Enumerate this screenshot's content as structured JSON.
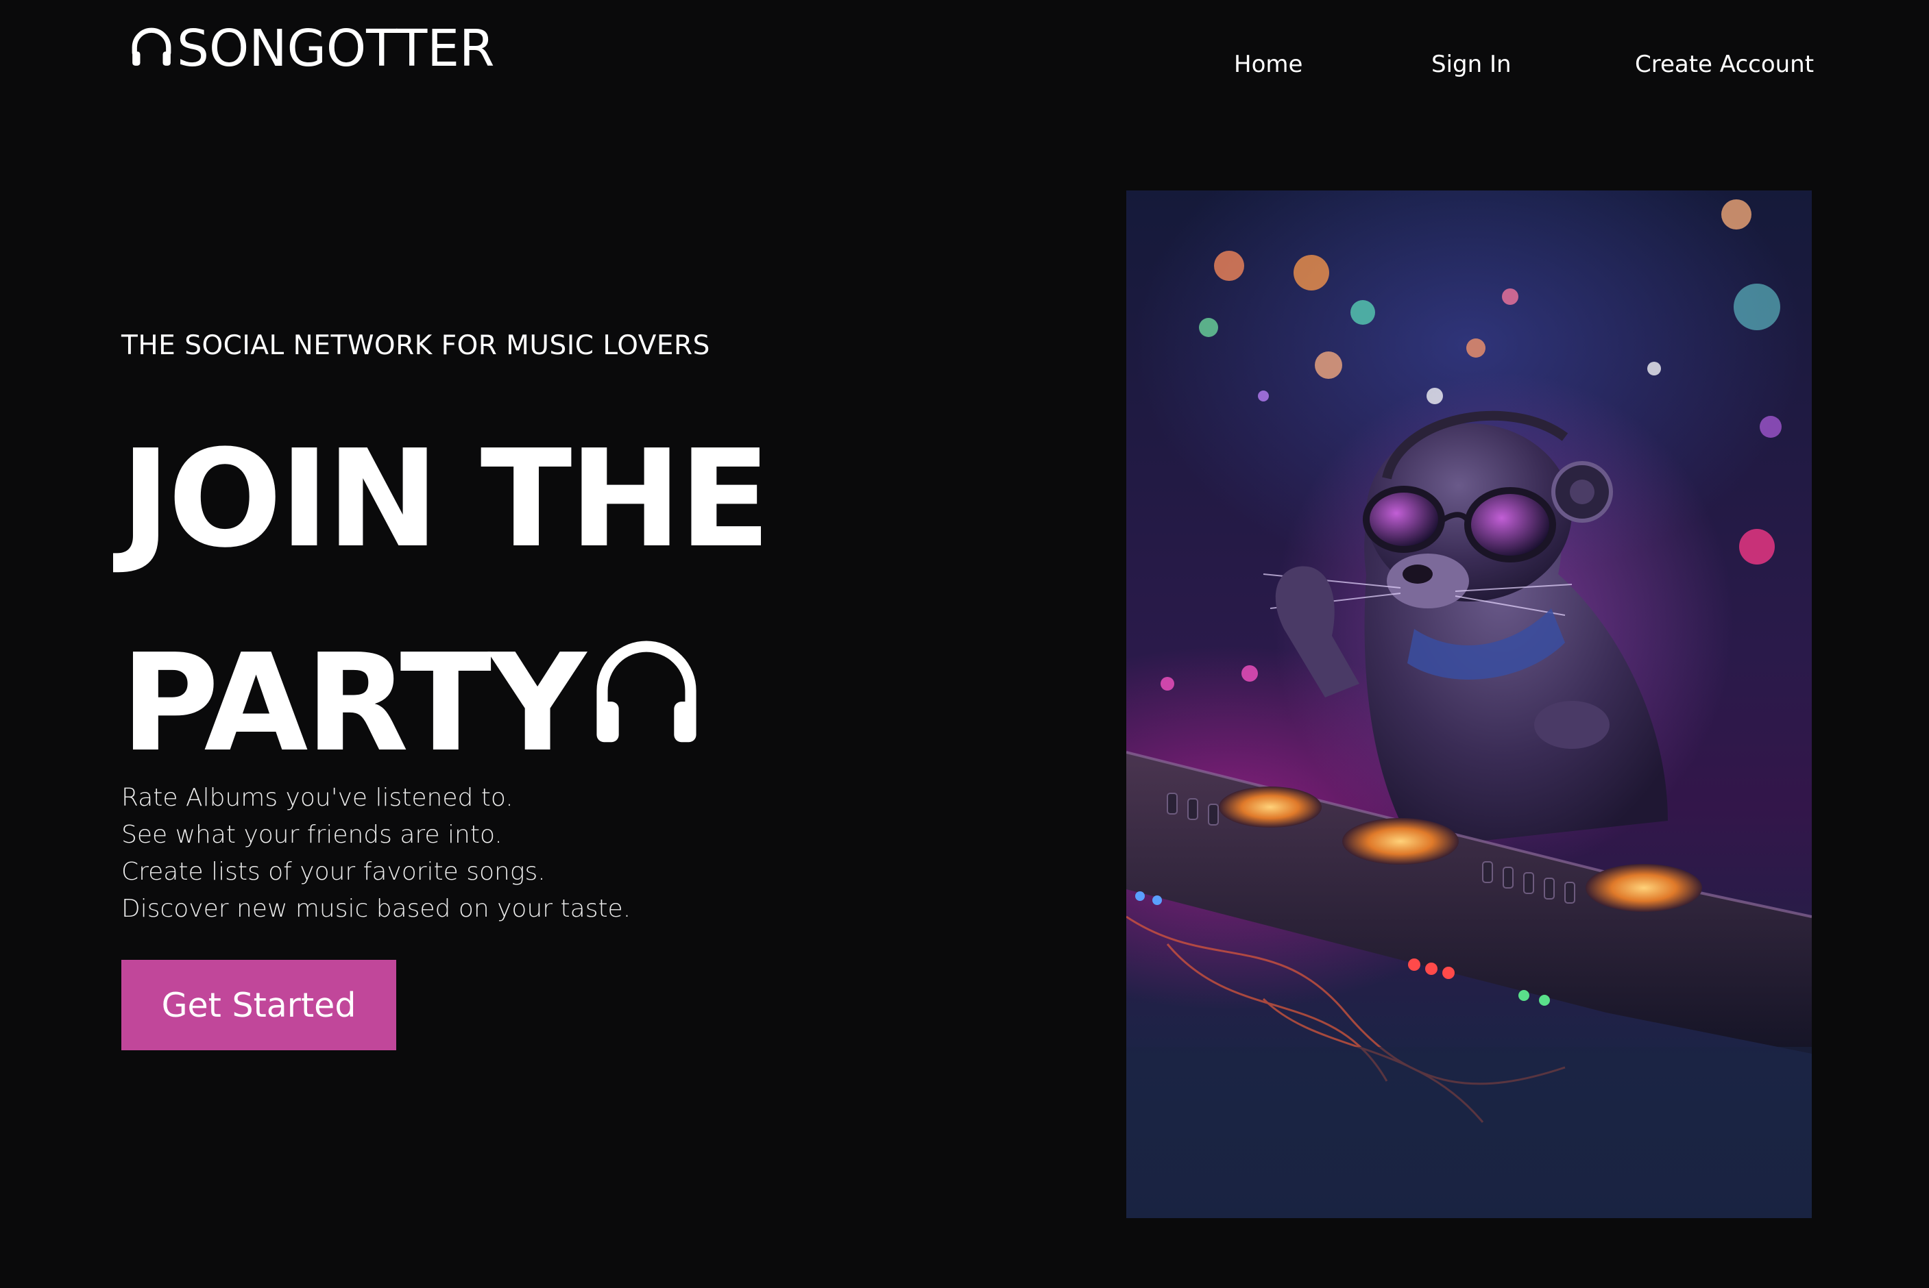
{
  "header": {
    "brand": "SONGOTTER",
    "brand_icon": "headphones-icon",
    "nav": {
      "home": "Home",
      "sign_in": "Sign In",
      "create_account": "Create Account"
    }
  },
  "hero": {
    "eyebrow": "THE SOCIAL NETWORK FOR MUSIC LOVERS",
    "headline_line1": "JOIN THE",
    "headline_line2": "PARTY",
    "headline_icon": "headphones-icon",
    "features": [
      "Rate Albums you've listened to.",
      "See what your friends are into.",
      "Create lists of your favorite songs.",
      "Discover new music based on your taste."
    ],
    "cta_label": "Get Started"
  },
  "illustration": {
    "subject": "otter-dj-illustration"
  },
  "colors": {
    "background": "#0a0a0b",
    "accent": "#c1479a",
    "text": "#ffffff"
  }
}
